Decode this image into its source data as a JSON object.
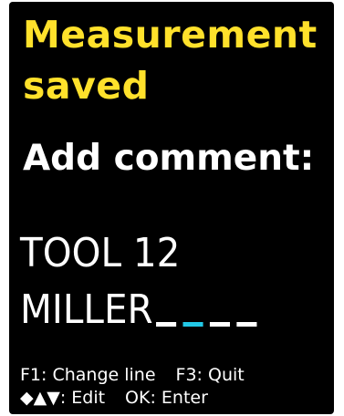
{
  "header": {
    "line1": "Measurement",
    "line2": "saved"
  },
  "prompt": {
    "label": "Add comment:"
  },
  "comment": {
    "line1": "TOOL 12",
    "line2": "MILLER"
  },
  "help": {
    "f1": "F1: Change line",
    "f3": "F3: Quit",
    "arrows_icon": "◆▲▼:",
    "arrows": "Edit",
    "ok": "OK: Enter"
  },
  "colors": {
    "title": "#ffe12b",
    "text": "#ffffff",
    "cursor": "#22c8e6",
    "background": "#000000"
  }
}
